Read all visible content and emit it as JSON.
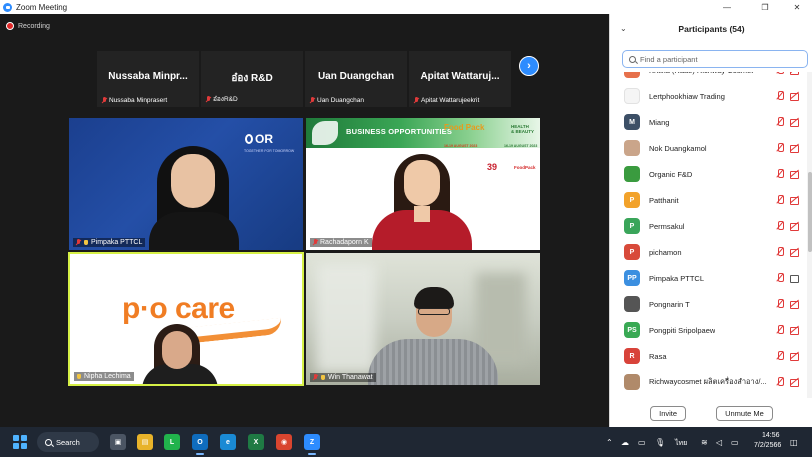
{
  "window": {
    "title": "Zoom Meeting",
    "controls": [
      "—",
      "❐",
      "✕"
    ]
  },
  "recording": {
    "label": "Recording"
  },
  "strip": [
    {
      "display": "Nussaba  Minpr...",
      "name": "Nussaba Minprasert"
    },
    {
      "display": "อ๋อง R&D",
      "name": "อ๋องR&D"
    },
    {
      "display": "Uan  Duangchan",
      "name": "Uan  Duangchan"
    },
    {
      "display": "Apitat  Wattaruj...",
      "name": "Apitat Wattarujeekrit"
    }
  ],
  "next_button": {
    "glyph": "›"
  },
  "tiles": [
    {
      "name": "Pimpaka PTTCL"
    },
    {
      "name": "Rachadaporn K"
    },
    {
      "name": "Nipha Lechima"
    },
    {
      "name": "Win Thanawat"
    }
  ],
  "tile_content": {
    "or_logo": "OR",
    "or_tagline": "TOGETHER FOR TOMORROW",
    "banner_title": "BUSINESS OPPORTUNITIES",
    "expo_food": "Food Pack",
    "expo_food_dates": "16-19 AUGUST 2023",
    "expo_health_top": "HEALTH",
    "expo_health_bottom": "& BEAUTY",
    "expo_health_dates": "16-19 AUGUST 2023",
    "brand_39": "39",
    "brand_small": "FoodPack",
    "pocare": "p·o care"
  },
  "panel": {
    "title": "Participants (54)",
    "collapse_glyph": "⌄",
    "search_placeholder": "Find a participant",
    "invite_label": "Invite",
    "unmute_label": "Unmute Me"
  },
  "participants": [
    {
      "name": "Kritika (Raae) Richway Cosmet",
      "initial": "",
      "color": "#e6704b",
      "cam": "off"
    },
    {
      "name": "Lertphookhiaw Trading",
      "initial": "",
      "color": "#f5f5f5",
      "cam": "off"
    },
    {
      "name": "Miang",
      "initial": "M",
      "color": "#3c4f66",
      "cam": "off"
    },
    {
      "name": "Nok Duangkamol",
      "initial": "",
      "color": "#caa58a",
      "cam": "off"
    },
    {
      "name": "Organic F&D",
      "initial": "",
      "color": "#3a9b3f",
      "cam": "off"
    },
    {
      "name": "Patthanit",
      "initial": "P",
      "color": "#f2a22a",
      "cam": "off"
    },
    {
      "name": "Permsakul",
      "initial": "P",
      "color": "#3aa55a",
      "cam": "off"
    },
    {
      "name": "pichamon",
      "initial": "P",
      "color": "#d84a3a",
      "cam": "off"
    },
    {
      "name": "Pimpaka PTTCL",
      "initial": "PP",
      "color": "#3b8fe0",
      "cam": "on"
    },
    {
      "name": "Pongnarin T",
      "initial": "",
      "color": "#555555",
      "cam": "off"
    },
    {
      "name": "Pongpiti Sripolpaew",
      "initial": "PS",
      "color": "#39a954",
      "cam": "off"
    },
    {
      "name": "Rasa",
      "initial": "R",
      "color": "#d8433a",
      "cam": "off"
    },
    {
      "name": "Richwaycosmet ผลิตเครื่องสำอาง/...",
      "initial": "",
      "color": "#b08a6a",
      "cam": "off"
    }
  ],
  "taskbar": {
    "search_label": "Search",
    "apps": [
      {
        "name": "task-view",
        "label": "▣",
        "color": "#4b5563"
      },
      {
        "name": "file-explorer",
        "label": "▤",
        "color": "#e8b32a"
      },
      {
        "name": "line",
        "label": "L",
        "color": "#21b34c"
      },
      {
        "name": "outlook",
        "label": "O",
        "color": "#0f6cbd"
      },
      {
        "name": "edge",
        "label": "e",
        "color": "#1a8ad4"
      },
      {
        "name": "excel",
        "label": "X",
        "color": "#1f7a44"
      },
      {
        "name": "chrome",
        "label": "◉",
        "color": "#d9452f"
      },
      {
        "name": "zoom",
        "label": "Z",
        "color": "#2d8cff"
      }
    ],
    "lang": "ไทย",
    "time": "14:56",
    "date": "7/2/2566"
  }
}
